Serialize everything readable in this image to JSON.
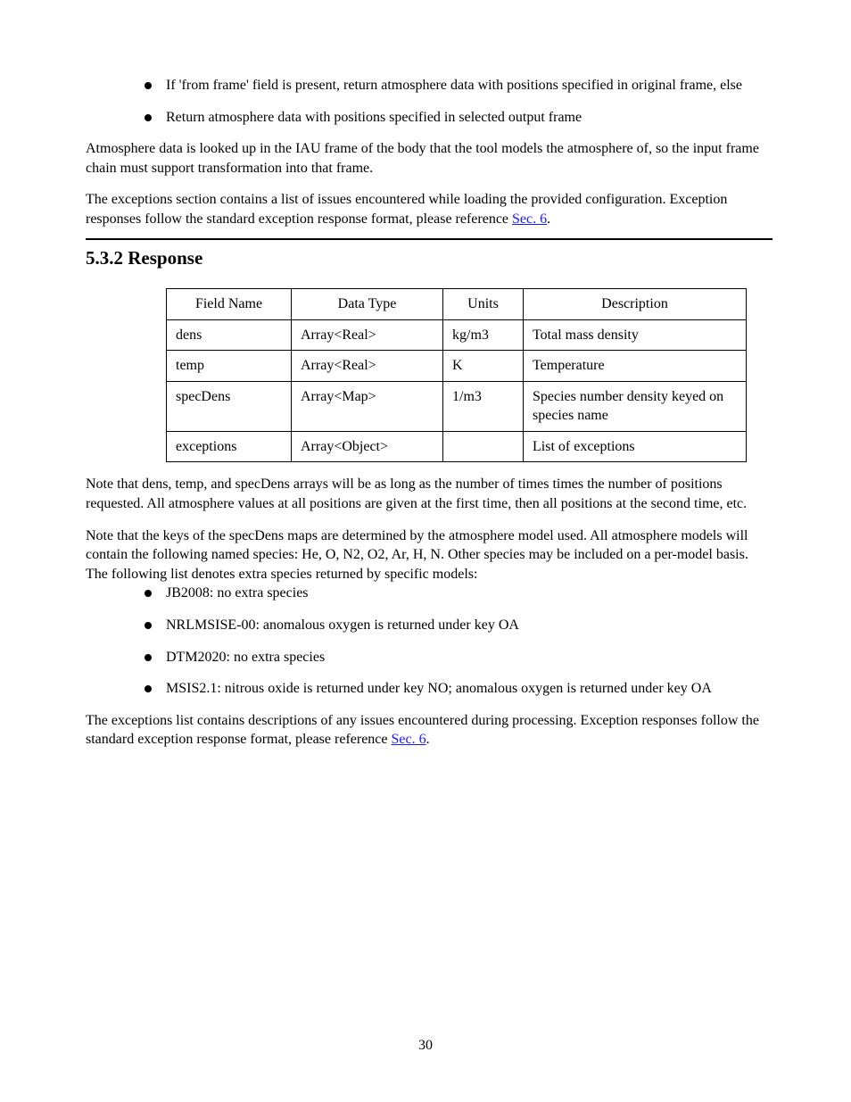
{
  "bullets": [
    "If 'from frame' field is present, return atmosphere data with positions specified in original frame, else",
    "Return atmosphere data with positions specified in selected output frame"
  ],
  "paragraphs": {
    "p1": "Atmosphere data is looked up in the IAU frame of the body that the tool models the atmosphere of, so the input frame chain must support transformation into that frame.",
    "p2_prefix": "The exceptions section contains a list of issues encountered while loading the provided configuration. Exception responses follow the standard exception response format, please reference ",
    "p2_link": "Sec. 6",
    "p2_suffix": "."
  },
  "section_title": "5.3.2 Response",
  "table": {
    "headers": [
      "Field Name",
      "Data Type",
      "Units",
      "Description"
    ],
    "rows": [
      [
        "dens",
        "Array<Real>",
        "kg/m3",
        "Total mass density"
      ],
      [
        "temp",
        "Array<Real>",
        "K",
        "Temperature"
      ],
      [
        "specDens",
        "Array<Map>",
        "1/m3",
        "Species number density keyed on species name"
      ],
      [
        "exceptions",
        "Array<Object>",
        "",
        "List of exceptions"
      ]
    ]
  },
  "below_table": {
    "p1_part1": "Note that ",
    "p1_code1": "dens",
    "p1_part2": ", ",
    "p1_code2": "temp",
    "p1_part3": ", and ",
    "p1_code3": "specDens",
    "p1_part4": " arrays will be as long as the number of times times the number of positions requested. All atmosphere values at all positions are given at the first time, then all positions at the second time, etc.",
    "p2_part1": "Note that the keys of the ",
    "p2_code1": "specDens",
    "p2_part2": " maps are determined by the atmosphere model used. All atmosphere models will contain the following named species: He, O, N2, O2, Ar, H, N. Other species may be included on a per-model basis. The following list denotes extra species returned by specific models:",
    "p3_part1": "The exceptions list contains descriptions of any issues encountered during processing. Exception responses follow the standard exception response format, please reference ",
    "p3_link": "Sec. 6",
    "p3_part2": "."
  },
  "lower_bullets": [
    {
      "prefix": "JB2008: ",
      "rest": "no extra species"
    },
    {
      "prefix": "NRLMSISE-00: ",
      "rest": "anomalous oxygen is returned under key OA"
    },
    {
      "prefix": "DTM2020: ",
      "rest": "no extra species"
    },
    {
      "prefix": "MSIS2.1: ",
      "rest": "nitrous oxide is returned under key NO; anomalous oxygen is returned under key OA"
    }
  ],
  "footer_page": "30"
}
